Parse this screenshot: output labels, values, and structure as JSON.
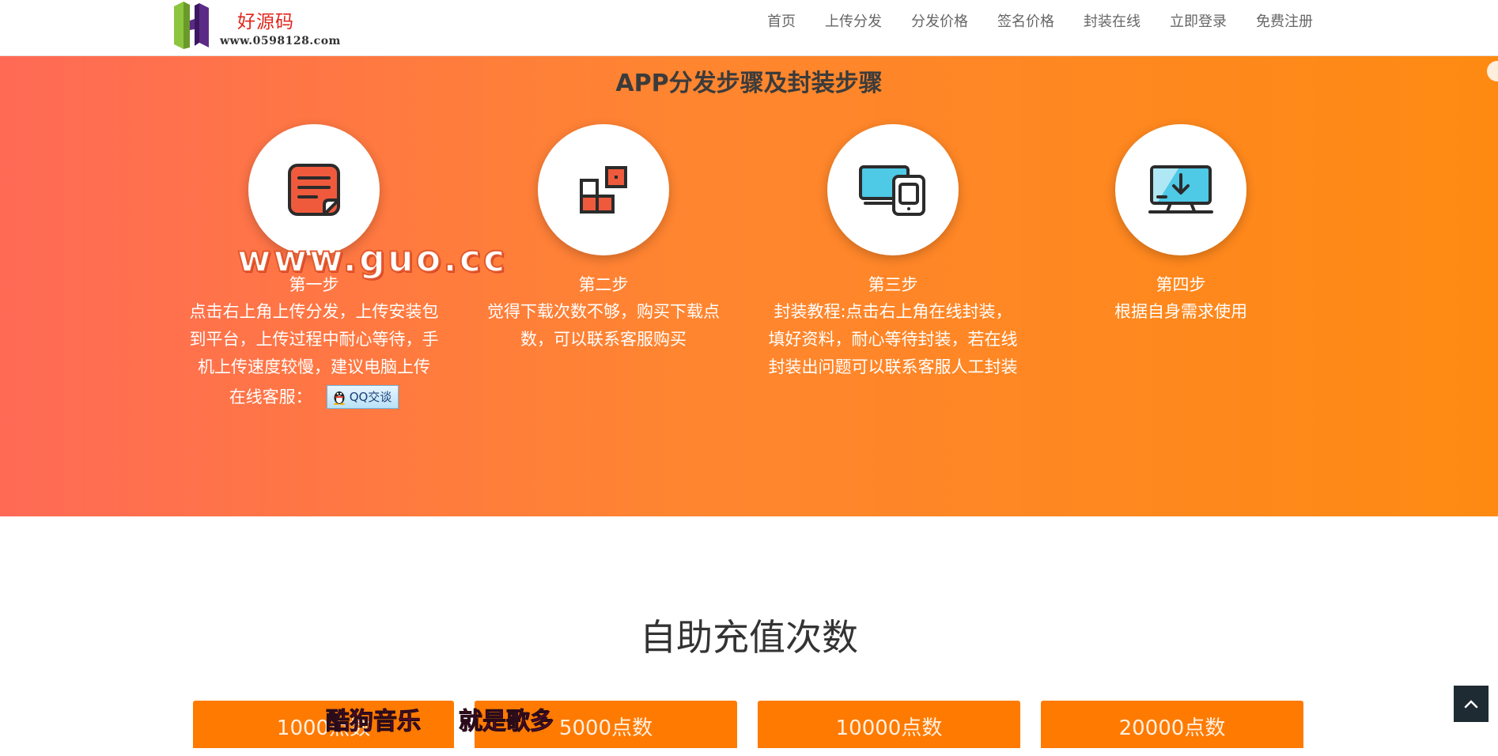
{
  "header": {
    "logo_text": "好源码",
    "logo_url": "www.0598128.com",
    "nav": [
      "首页",
      "上传分发",
      "分发价格",
      "签名价格",
      "封装在线",
      "立即登录",
      "免费注册"
    ]
  },
  "hero": {
    "title": "APP分发步骤及封装步骤",
    "steps": [
      {
        "title": "第一步",
        "desc": "点击右上角上传分发，上传安装包到平台，上传过程中耐心等待，手机上传速度较慢，建议电脑上传",
        "icon": "note-icon"
      },
      {
        "title": "第二步",
        "desc": "觉得下载次数不够，购买下载点数，可以联系客服购买",
        "icon": "blocks-icon"
      },
      {
        "title": "第三步",
        "desc": "封装教程:点击右上角在线封装，填好资料，耐心等待封装，若在线封装出问题可以联系客服人工封装",
        "icon": "devices-icon"
      },
      {
        "title": "第四步",
        "desc": "根据自身需求使用",
        "icon": "monitor-download-icon"
      }
    ],
    "kefu_label": "在线客服：",
    "qq_button": "QQ交谈",
    "watermark": "www.guo.cc"
  },
  "recharge": {
    "title": "自助充值次数",
    "cards": [
      "1000点数",
      "5000点数",
      "10000点数",
      "20000点数"
    ],
    "overlay_a": "酷狗音乐",
    "overlay_b": "就是歌多"
  },
  "colors": {
    "hero_start": "#ff6a56",
    "hero_end": "#ff8a12",
    "card": "#ff7a00",
    "icon_red": "#ef5a3c",
    "icon_cyan": "#4ec9e6"
  }
}
